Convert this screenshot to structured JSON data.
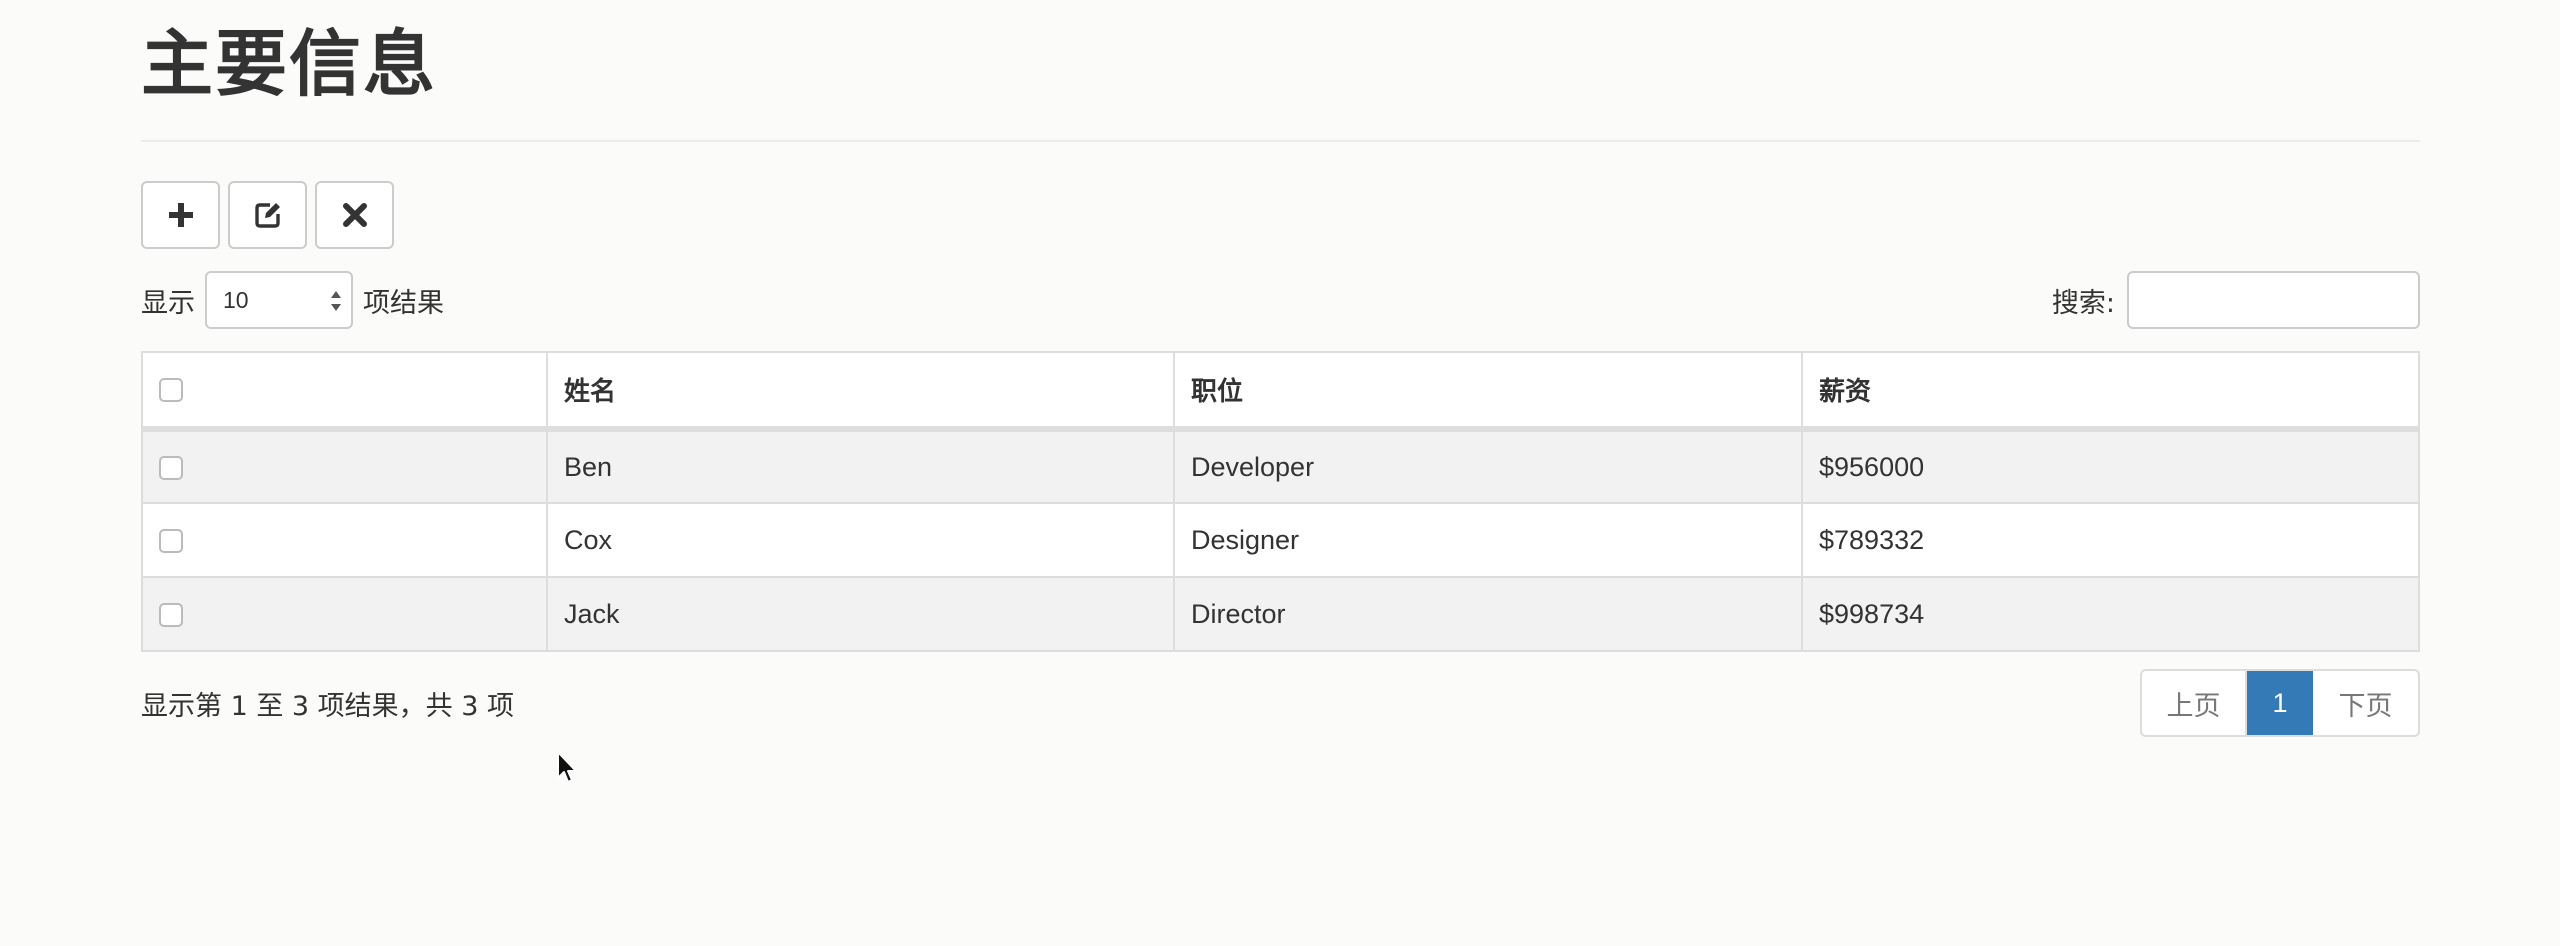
{
  "page": {
    "title": "主要信息"
  },
  "toolbar": {
    "buttons": [
      {
        "icon": "plus-icon"
      },
      {
        "icon": "edit-icon"
      },
      {
        "icon": "close-icon"
      }
    ]
  },
  "length_control": {
    "prefix": "显示",
    "value": "10",
    "suffix": "项结果"
  },
  "search": {
    "label": "搜索:",
    "value": ""
  },
  "table": {
    "headers": [
      "姓名",
      "职位",
      "薪资"
    ],
    "rows": [
      {
        "name": "Ben",
        "position": "Developer",
        "salary": "$956000"
      },
      {
        "name": "Cox",
        "position": "Designer",
        "salary": "$789332"
      },
      {
        "name": "Jack",
        "position": "Director",
        "salary": "$998734"
      }
    ]
  },
  "info": "显示第 1 至 3 项结果，共 3 项",
  "pagination": {
    "prev": "上页",
    "current": "1",
    "next": "下页"
  },
  "colors": {
    "accent": "#337ab7",
    "border": "#dddddd",
    "stripe": "#f2f2f2"
  }
}
